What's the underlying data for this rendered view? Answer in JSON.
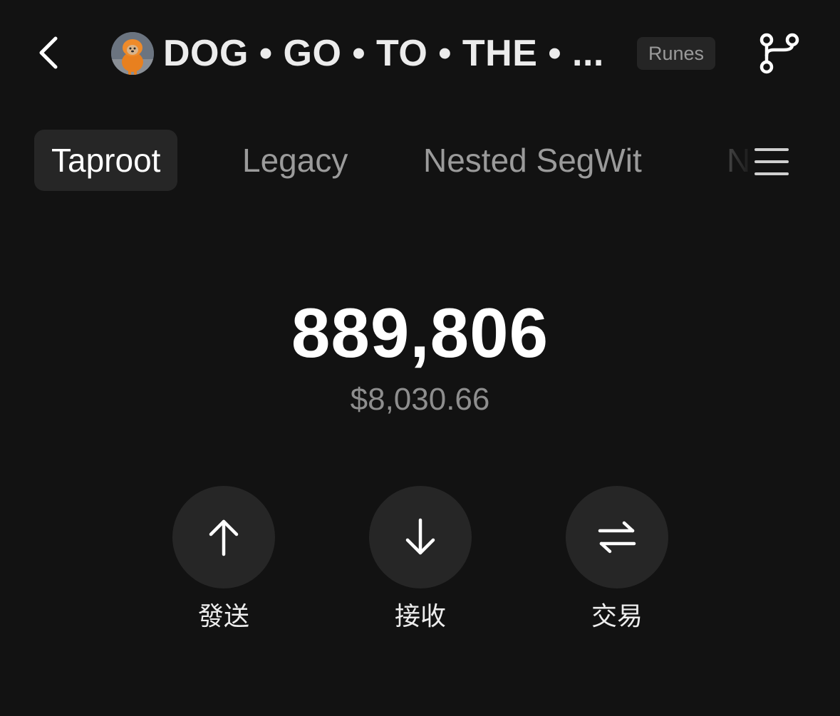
{
  "header": {
    "back_icon": "chevron-left-icon",
    "avatar_icon": "dog-token-avatar",
    "title": "DOG • GO • TO • THE • ...",
    "badge": "Runes",
    "branch_icon": "git-branch-icon"
  },
  "tabs": {
    "items": [
      {
        "label": "Taproot",
        "active": true
      },
      {
        "label": "Legacy",
        "active": false
      },
      {
        "label": "Nested SegWit",
        "active": false
      },
      {
        "label": "N",
        "active": false
      }
    ],
    "menu_icon": "hamburger-menu-icon"
  },
  "balance": {
    "amount": "889,806",
    "fiat": "$8,030.66"
  },
  "actions": [
    {
      "label": "發送",
      "icon": "arrow-up-icon"
    },
    {
      "label": "接收",
      "icon": "arrow-down-icon"
    },
    {
      "label": "交易",
      "icon": "swap-arrows-icon"
    }
  ],
  "colors": {
    "background": "#121212",
    "surface": "#262626",
    "text_primary": "#ffffff",
    "text_secondary": "#8e8e8e",
    "badge_text": "#9a9a9a"
  }
}
